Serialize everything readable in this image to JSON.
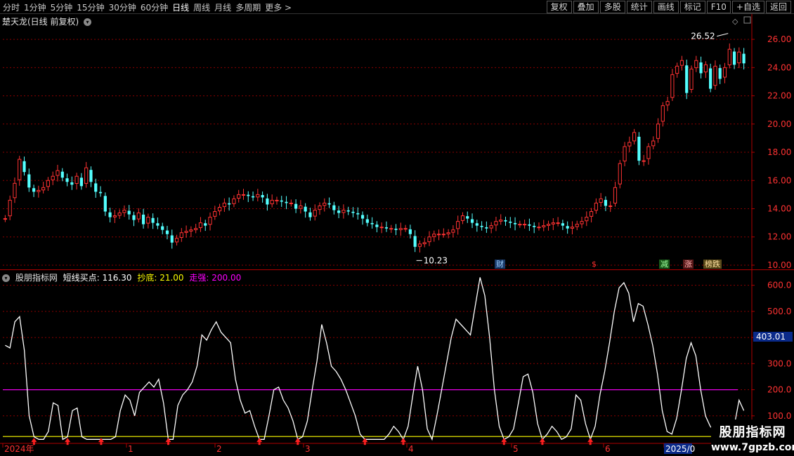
{
  "toolbar": {
    "periods": [
      "分时",
      "1分钟",
      "5分钟",
      "15分钟",
      "30分钟",
      "60分钟",
      "日线",
      "周线",
      "月线",
      "多周期",
      "更多 >"
    ],
    "active_period": "日线",
    "buttons": [
      "复权",
      "叠加",
      "多股",
      "统计",
      "画线",
      "F10",
      "+自选",
      "返回"
    ],
    "right_labels": [
      "标记"
    ]
  },
  "title": "楚天龙(日线 前复权)",
  "indicator": {
    "name": "股朋指标网",
    "line1_label": "短线买点: 116.30",
    "line2_label": "抄底: 21.00",
    "line3_label": "走强: 200.00"
  },
  "markers": {
    "cai": "财",
    "s": "$",
    "jian": "减",
    "zhang": "涨",
    "bang": "榜跌"
  },
  "annotations": {
    "high": "26.52",
    "low": "10.23",
    "current_value": "403.01"
  },
  "time_axis": [
    "2024年",
    "1",
    "2",
    "3",
    "4",
    "5",
    "6",
    "2025/0"
  ],
  "watermark": {
    "line1": "股朋指标网",
    "line2": "www.7gpzb.com"
  },
  "colors": {
    "up": "#ff3232",
    "down": "#54ffff",
    "line": "#ffffff",
    "strong": "#ff00ff",
    "bottom": "#ffff00",
    "grid": "#8b0000"
  },
  "chart_data": [
    {
      "type": "candlestick",
      "title": "楚天龙(日线 前复权)",
      "y_ticks": [
        26.0,
        24.0,
        22.0,
        20.0,
        18.0,
        16.0,
        14.0,
        12.0,
        10.0
      ],
      "ylim": [
        9.8,
        26.9
      ],
      "close": [
        13.3,
        14.6,
        15.8,
        17.5,
        16.6,
        15.5,
        15.2,
        15.3,
        15.5,
        16.0,
        16.3,
        16.7,
        16.2,
        15.9,
        15.7,
        16.3,
        15.6,
        16.9,
        15.9,
        15.2,
        15.1,
        13.8,
        13.4,
        13.5,
        13.7,
        13.9,
        13.6,
        13.2,
        13.7,
        12.9,
        13.4,
        13.0,
        12.8,
        12.5,
        12.2,
        11.6,
        11.9,
        12.3,
        12.4,
        12.5,
        12.6,
        13.0,
        12.8,
        13.4,
        13.8,
        14.1,
        14.4,
        14.3,
        14.7,
        15.0,
        15.0,
        14.9,
        14.8,
        15.0,
        14.8,
        14.3,
        14.6,
        14.6,
        14.5,
        14.4,
        14.4,
        14.0,
        14.2,
        13.8,
        13.4,
        13.9,
        14.2,
        14.4,
        14.3,
        13.9,
        13.7,
        13.9,
        13.8,
        13.7,
        13.6,
        13.3,
        13.0,
        12.9,
        12.7,
        12.7,
        12.6,
        12.6,
        12.5,
        12.6,
        12.6,
        12.2,
        11.3,
        11.5,
        11.6,
        12.0,
        12.2,
        12.2,
        12.2,
        12.3,
        12.5,
        13.1,
        13.5,
        13.3,
        13.0,
        12.8,
        12.7,
        12.6,
        12.8,
        13.1,
        13.2,
        13.1,
        13.0,
        12.9,
        12.9,
        12.9,
        12.8,
        12.7,
        12.7,
        12.8,
        12.9,
        13.0,
        13.0,
        12.8,
        12.6,
        12.7,
        12.9,
        13.1,
        13.4,
        13.8,
        14.4,
        14.7,
        14.2,
        14.2,
        15.5,
        17.2,
        18.4,
        18.7,
        19.4,
        17.4,
        17.4,
        18.4,
        18.8,
        20.0,
        21.3,
        21.6,
        23.5,
        24.1,
        24.5,
        22.2,
        23.9,
        24.5,
        23.6,
        24.2,
        22.5,
        24.1,
        23.2,
        24.0,
        25.3,
        24.2,
        25.1,
        24.3
      ],
      "annotations": {
        "high": 26.52,
        "low": 10.23
      }
    },
    {
      "type": "line",
      "title": "股朋指标网",
      "y_ticks": [
        600.0,
        500.0,
        400.0,
        300.0,
        200.0,
        100.0
      ],
      "ylim": [
        0,
        650
      ],
      "series": [
        {
          "name": "短线买点",
          "values": [
            370,
            360,
            460,
            480,
            350,
            100,
            20,
            10,
            10,
            40,
            150,
            140,
            10,
            20,
            120,
            130,
            20,
            10,
            10,
            10,
            10,
            10,
            10,
            20,
            120,
            180,
            160,
            100,
            190,
            210,
            230,
            210,
            240,
            150,
            10,
            10,
            140,
            180,
            200,
            230,
            290,
            410,
            390,
            430,
            460,
            420,
            400,
            380,
            240,
            160,
            110,
            120,
            60,
            10,
            10,
            100,
            200,
            210,
            160,
            130,
            80,
            10,
            20,
            80,
            200,
            310,
            450,
            380,
            290,
            270,
            240,
            200,
            150,
            100,
            30,
            10,
            10,
            10,
            10,
            10,
            30,
            60,
            40,
            10,
            60,
            180,
            290,
            200,
            50,
            10,
            100,
            200,
            300,
            400,
            470,
            450,
            430,
            410,
            520,
            630,
            560,
            400,
            200,
            60,
            10,
            20,
            50,
            150,
            250,
            260,
            190,
            70,
            10,
            30,
            60,
            40,
            10,
            20,
            50,
            180,
            160,
            70,
            10,
            60,
            180,
            270,
            380,
            500,
            590,
            610,
            570,
            460,
            530,
            520,
            450,
            370,
            260,
            120,
            40,
            30,
            90,
            200,
            320,
            380,
            330,
            200,
            100,
            60,
            40,
            80,
            20,
            20,
            60,
            160,
            120
          ]
        },
        {
          "name": "走强",
          "values": [
            200
          ]
        },
        {
          "name": "抄底",
          "values": [
            21
          ]
        }
      ]
    }
  ]
}
